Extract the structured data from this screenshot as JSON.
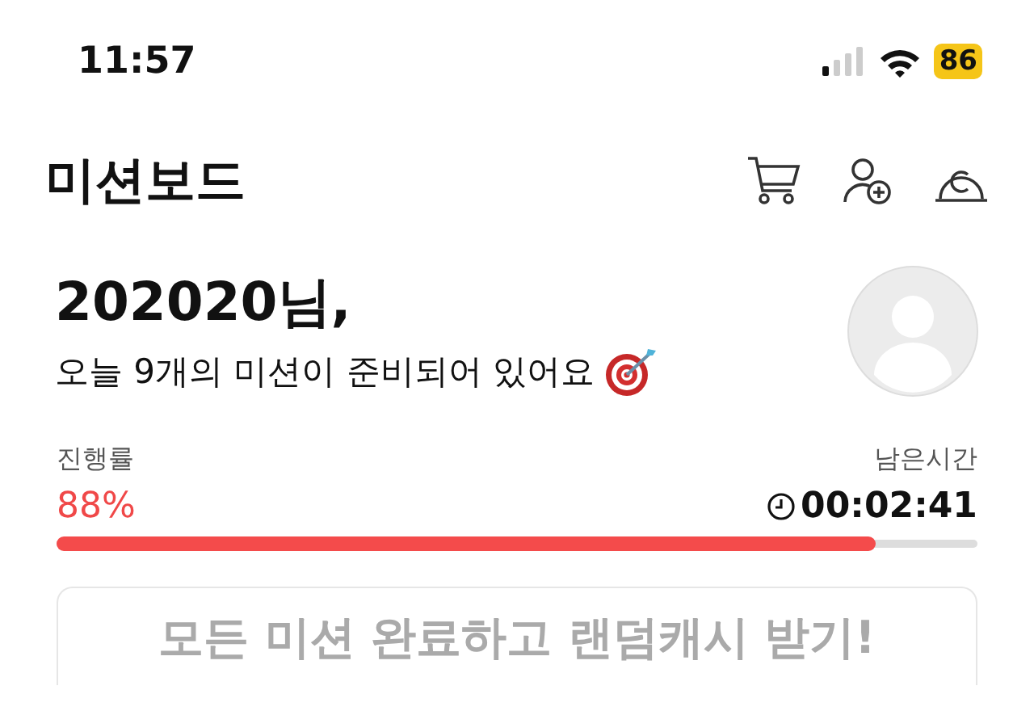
{
  "status_bar": {
    "time": "11:57",
    "battery": "86"
  },
  "header": {
    "title": "미션보드"
  },
  "greeting": {
    "name": "202020님,",
    "message": "오늘 9개의 미션이 준비되어 있어요"
  },
  "progress": {
    "label": "진행률",
    "value": "88%",
    "level": 0.89,
    "remaining_label": "남은시간",
    "remaining": "00:02:41"
  },
  "mission_card": {
    "text": "모든 미션 완료하고 랜덤캐시 받기!"
  }
}
